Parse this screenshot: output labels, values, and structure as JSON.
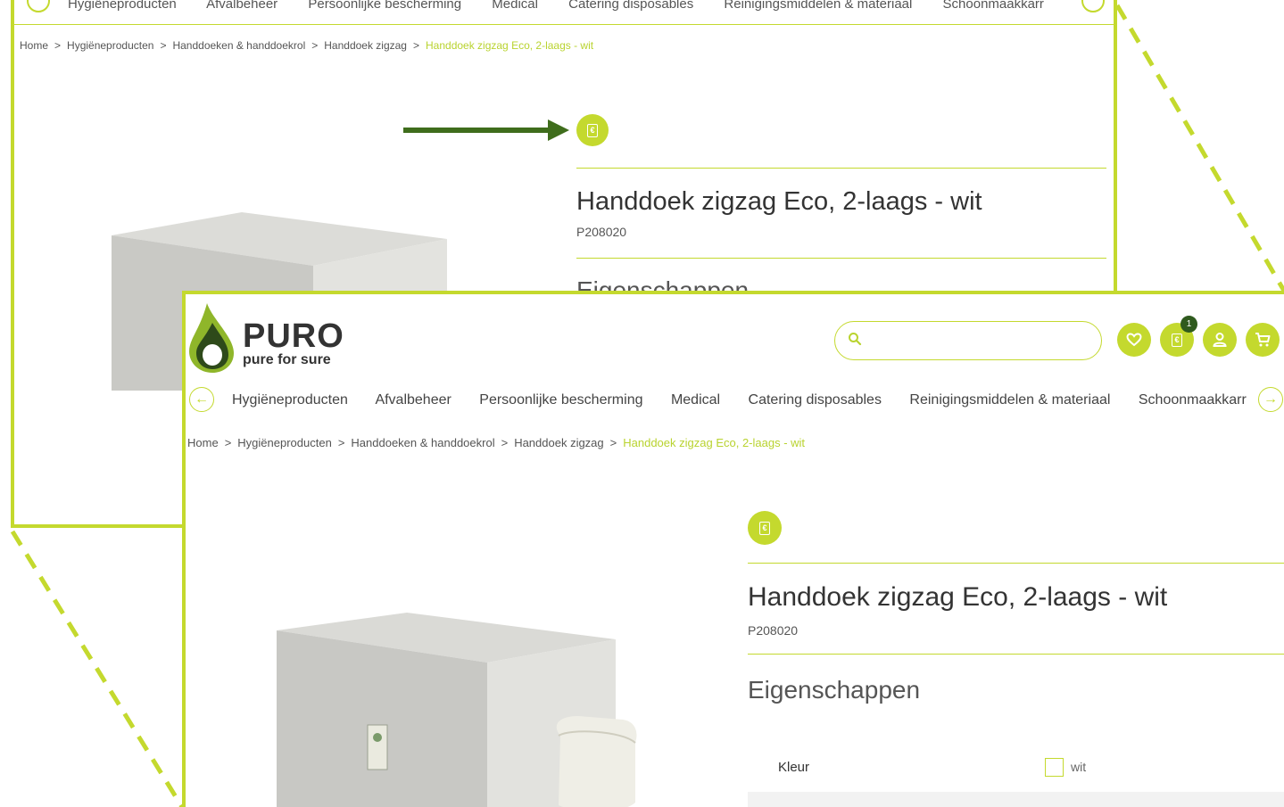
{
  "colors": {
    "accent": "#c4d92e",
    "accent_text": "#b9d32f",
    "dark_green": "#2f5a1e",
    "arrow": "#3f6d1c"
  },
  "back_view": {
    "nav_items": [
      "Hygiëneproducten",
      "Afvalbeheer",
      "Persoonlijke bescherming",
      "Medical",
      "Catering disposables",
      "Reinigingsmiddelen & materiaal",
      "Schoonmaakkarr"
    ],
    "breadcrumb": [
      "Home",
      "Hygiëneproducten",
      "Handdoeken & handdoekrol",
      "Handdoek zigzag",
      "Handdoek zigzag Eco, 2-laags - wit"
    ],
    "title": "Handdoek zigzag Eco, 2-laags - wit",
    "sku": "P208020",
    "properties_heading": "Eigenschappen"
  },
  "header": {
    "logo_name": "PURO",
    "logo_tagline": "pure for sure",
    "search_placeholder": "",
    "icons": {
      "wishlist": "heart-icon",
      "quote": "quote-document-icon",
      "account": "user-icon",
      "cart": "cart-icon"
    },
    "quote_count": "1"
  },
  "nav": {
    "items": [
      "Hygiëneproducten",
      "Afvalbeheer",
      "Persoonlijke bescherming",
      "Medical",
      "Catering disposables",
      "Reinigingsmiddelen & materiaal",
      "Schoonmaakkarr"
    ]
  },
  "breadcrumb": [
    "Home",
    "Hygiëneproducten",
    "Handdoeken & handdoekrol",
    "Handdoek zigzag",
    "Handdoek zigzag Eco, 2-laags - wit"
  ],
  "breadcrumb_separator": ">",
  "product": {
    "title": "Handdoek zigzag Eco, 2-laags - wit",
    "sku": "P208020",
    "properties_heading": "Eigenschappen",
    "specs": [
      {
        "label": "Kleur",
        "value": "wit"
      }
    ]
  }
}
